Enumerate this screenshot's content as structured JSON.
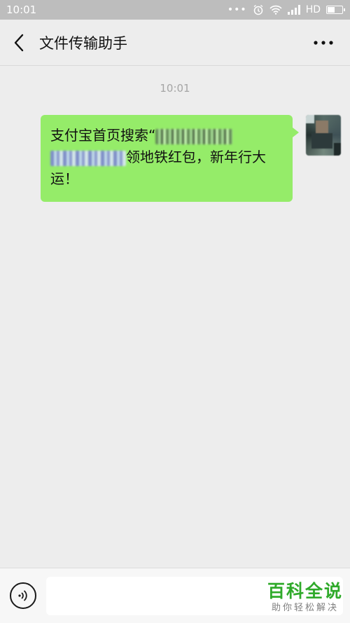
{
  "status_bar": {
    "time": "10:01",
    "more_dots": "•••",
    "network": "HD"
  },
  "header": {
    "title": "文件传输助手"
  },
  "conversation": {
    "timestamp": "10:01",
    "message": {
      "prefix": "支付宝首页搜索“",
      "middle": "领地铁红包，新年行大",
      "suffix": "运！"
    }
  },
  "watermark": {
    "line1": "百科全说",
    "line2": "助你轻松解决"
  },
  "colors": {
    "bubble": "#95ec69",
    "background": "#ededed",
    "status_bar": "#bdbdbd",
    "watermark_green": "#2faa2a"
  },
  "icons": [
    "back-arrow-icon",
    "more-options-icon",
    "voice-input-icon",
    "alarm-icon",
    "wifi-icon",
    "signal-icon",
    "battery-icon"
  ]
}
